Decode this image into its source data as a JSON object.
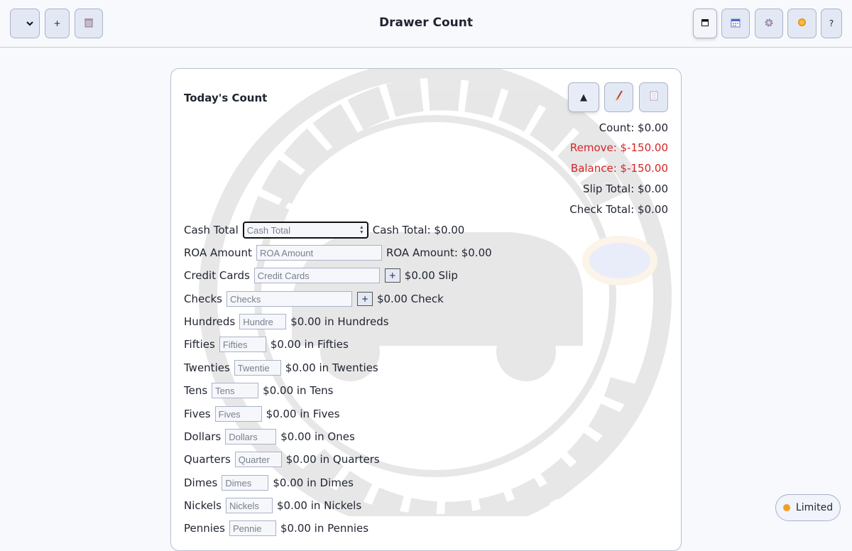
{
  "header": {
    "title": "Drawer Count",
    "add_label": "+",
    "help_label": "?",
    "status_label": "Limited",
    "icons": {
      "menu": "chevron-down-icon",
      "delete": "trash-icon",
      "drawer": "drawer-icon",
      "calendar": "calendar-icon",
      "settings": "gear-icon",
      "theme": "sun-icon"
    }
  },
  "card": {
    "title": "Today's Count",
    "collapse_label": "▲",
    "icons": {
      "clear": "broom-icon",
      "report": "receipt-icon"
    },
    "summary": {
      "count": "Count: $0.00",
      "remove": "Remove: $-150.00",
      "balance": "Balance: $-150.00",
      "slip_total": "Slip Total: $0.00",
      "check_total": "Check Total: $0.00"
    },
    "rows": [
      {
        "label": "Cash Total",
        "placeholder": "Cash Total",
        "output": "Cash Total: $0.00"
      },
      {
        "label": "ROA Amount",
        "placeholder": "ROA Amount",
        "output": "ROA Amount: $0.00"
      },
      {
        "label": "Credit Cards",
        "placeholder": "Credit Cards",
        "button": "+",
        "output": "$0.00 Slip"
      },
      {
        "label": "Checks",
        "placeholder": "Checks",
        "button": "+",
        "output": "$0.00 Check"
      },
      {
        "label": "Hundreds",
        "placeholder": "Hundre",
        "output": "$0.00 in Hundreds"
      },
      {
        "label": "Fifties",
        "placeholder": "Fifties",
        "output": "$0.00 in Fifties"
      },
      {
        "label": "Twenties",
        "placeholder": "Twentie",
        "output": "$0.00 in Twenties"
      },
      {
        "label": "Tens",
        "placeholder": "Tens",
        "output": "$0.00 in Tens"
      },
      {
        "label": "Fives",
        "placeholder": "Fives",
        "output": "$0.00 in Fives"
      },
      {
        "label": "Dollars",
        "placeholder": "Dollars",
        "output": "$0.00 in Ones"
      },
      {
        "label": "Quarters",
        "placeholder": "Quarter",
        "output": "$0.00 in Quarters"
      },
      {
        "label": "Dimes",
        "placeholder": "Dimes",
        "output": "$0.00 in Dimes"
      },
      {
        "label": "Nickels",
        "placeholder": "Nickels",
        "output": "$0.00 in Nickels"
      },
      {
        "label": "Pennies",
        "placeholder": "Pennie",
        "output": "$0.00 in Pennies"
      }
    ]
  },
  "colors": {
    "negative": "#d42525",
    "status_dot": "#f0a01f",
    "button_bg": "#e3e8f5"
  },
  "watermark": {
    "top": "SOUTHERN",
    "bottom": "AUTO SUPPLY"
  }
}
